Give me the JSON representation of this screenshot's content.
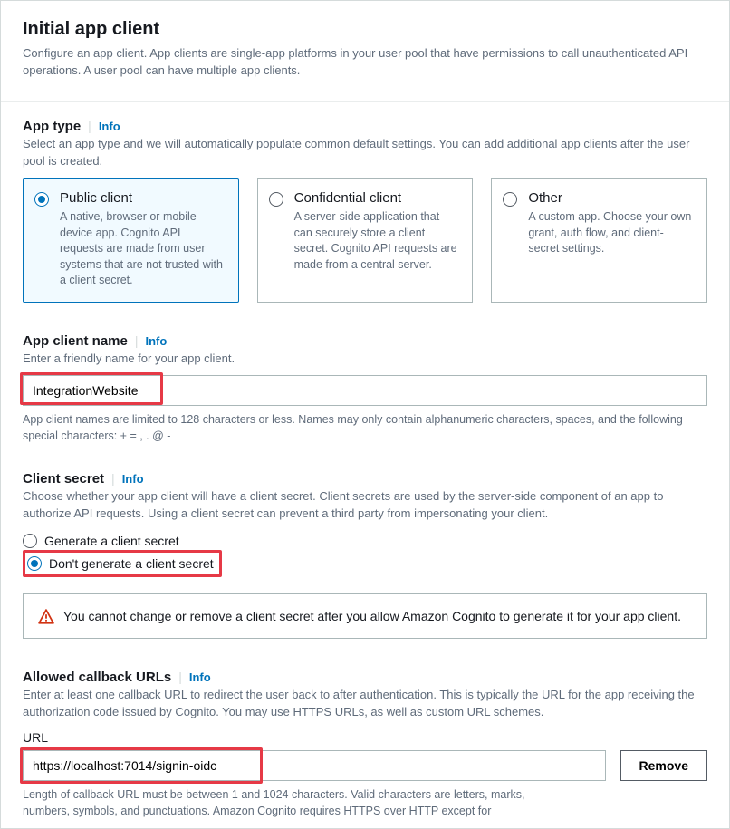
{
  "header": {
    "title": "Initial app client",
    "desc": "Configure an app client. App clients are single-app platforms in your user pool that have permissions to call unauthenticated API operations. A user pool can have multiple app clients."
  },
  "info_label": "Info",
  "appType": {
    "title": "App type",
    "help": "Select an app type and we will automatically populate common default settings. You can add additional app clients after the user pool is created.",
    "options": [
      {
        "title": "Public client",
        "desc": "A native, browser or mobile-device app. Cognito API requests are made from user systems that are not trusted with a client secret.",
        "selected": true
      },
      {
        "title": "Confidential client",
        "desc": "A server-side application that can securely store a client secret. Cognito API requests are made from a central server.",
        "selected": false
      },
      {
        "title": "Other",
        "desc": "A custom app. Choose your own grant, auth flow, and client-secret settings.",
        "selected": false
      }
    ]
  },
  "appClientName": {
    "title": "App client name",
    "help": "Enter a friendly name for your app client.",
    "value": "IntegrationWebsite",
    "after": "App client names are limited to 128 characters or less. Names may only contain alphanumeric characters, spaces, and the following special characters: + = , . @ -"
  },
  "clientSecret": {
    "title": "Client secret",
    "help": "Choose whether your app client will have a client secret. Client secrets are used by the server-side component of an app to authorize API requests. Using a client secret can prevent a third party from impersonating your client.",
    "opt_generate": "Generate a client secret",
    "opt_no_generate": "Don't generate a client secret",
    "alert": "You cannot change or remove a client secret after you allow Amazon Cognito to generate it for your app client."
  },
  "callback": {
    "title": "Allowed callback URLs",
    "help": "Enter at least one callback URL to redirect the user back to after authentication. This is typically the URL for the app receiving the authorization code issued by Cognito. You may use HTTPS URLs, as well as custom URL schemes.",
    "url_label": "URL",
    "url_value": "https://localhost:7014/signin-oidc",
    "remove_label": "Remove",
    "after": "Length of callback URL must be between 1 and 1024 characters. Valid characters are letters, marks, numbers, symbols, and punctuations. Amazon Cognito requires HTTPS over HTTP except for"
  }
}
